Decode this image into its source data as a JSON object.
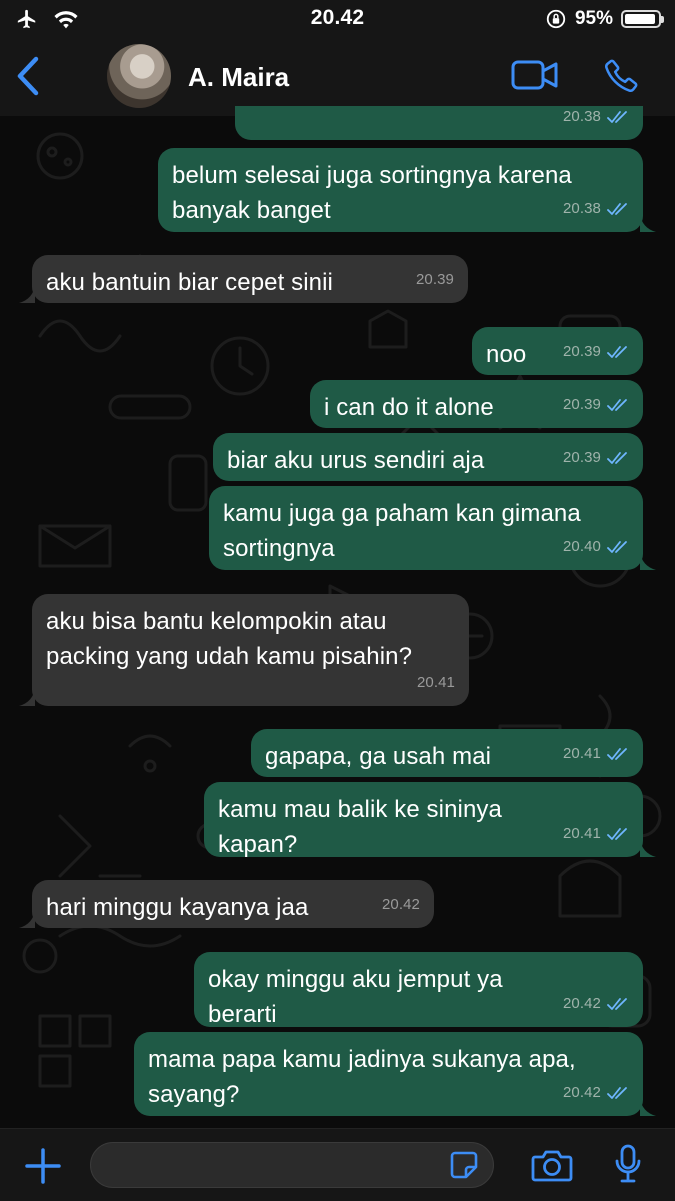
{
  "status_bar": {
    "time": "20.42",
    "battery": "95%",
    "icons": [
      "airplane-icon",
      "wifi-icon",
      "orientation-lock-icon",
      "battery-icon"
    ]
  },
  "header": {
    "contact_name": "A. Maira",
    "icons": [
      "back-chevron-icon",
      "avatar",
      "video-call-icon",
      "phone-call-icon"
    ]
  },
  "messages": [
    {
      "dir": "out",
      "text": "",
      "time": "20.38",
      "ticks": true
    },
    {
      "dir": "out",
      "text": "belum selesai juga sortingnya karena banyak banget",
      "time": "20.38",
      "ticks": true
    },
    {
      "dir": "in",
      "text": "aku bantuin biar cepet sinii",
      "time": "20.39"
    },
    {
      "dir": "out",
      "text": "noo",
      "time": "20.39",
      "ticks": true
    },
    {
      "dir": "out",
      "text": "i can do it alone",
      "time": "20.39",
      "ticks": true
    },
    {
      "dir": "out",
      "text": "biar aku urus sendiri aja",
      "time": "20.39",
      "ticks": true
    },
    {
      "dir": "out",
      "text": "kamu juga ga paham kan gimana sortingnya",
      "time": "20.40",
      "ticks": true
    },
    {
      "dir": "in",
      "text": "aku bisa bantu kelompokin atau packing yang udah kamu pisahin?",
      "time": "20.41"
    },
    {
      "dir": "out",
      "text": "gapapa, ga usah mai",
      "time": "20.41",
      "ticks": true
    },
    {
      "dir": "out",
      "text": "kamu mau balik ke sininya kapan?",
      "time": "20.41",
      "ticks": true
    },
    {
      "dir": "in",
      "text": "hari minggu kayanya jaa",
      "time": "20.42"
    },
    {
      "dir": "out",
      "text": "okay minggu aku jemput ya berarti",
      "time": "20.42",
      "ticks": true
    },
    {
      "dir": "out",
      "text": "mama papa kamu jadinya sukanya apa, sayang?",
      "time": "20.42",
      "ticks": true
    }
  ],
  "input_bar": {
    "placeholder": "",
    "icons": [
      "plus-icon",
      "sticker-icon",
      "camera-icon",
      "microphone-icon"
    ]
  },
  "colors": {
    "accent": "#3d8df5",
    "outgoing_bubble": "#1f5a46",
    "incoming_bubble": "#343434",
    "read_ticks": "#6fb6ff"
  }
}
